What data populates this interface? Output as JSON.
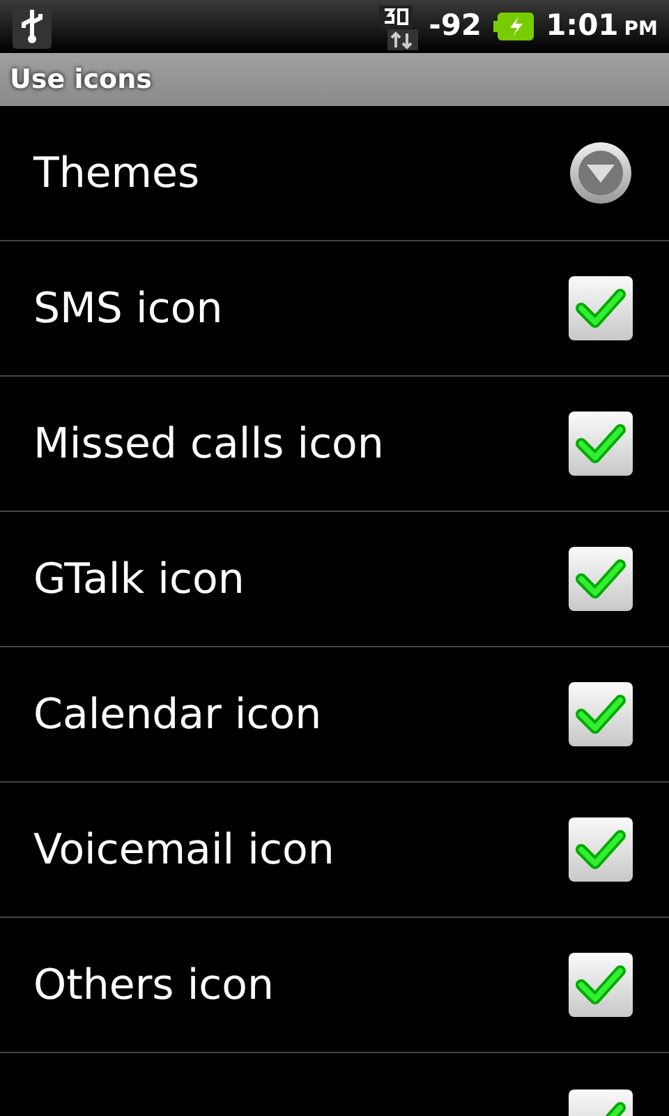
{
  "status_bar": {
    "signal": "-92",
    "time": "1:01",
    "ampm": "PM"
  },
  "header": {
    "title": "Use icons"
  },
  "rows": [
    {
      "kind": "dropdown",
      "label": "Themes"
    },
    {
      "kind": "checkbox",
      "label": "SMS icon",
      "checked": true
    },
    {
      "kind": "checkbox",
      "label": "Missed calls icon",
      "checked": true
    },
    {
      "kind": "checkbox",
      "label": "GTalk icon",
      "checked": true
    },
    {
      "kind": "checkbox",
      "label": "Calendar icon",
      "checked": true
    },
    {
      "kind": "checkbox",
      "label": "Voicemail icon",
      "checked": true
    },
    {
      "kind": "checkbox",
      "label": "Others icon",
      "checked": true
    },
    {
      "kind": "checkbox",
      "checked": true
    }
  ]
}
